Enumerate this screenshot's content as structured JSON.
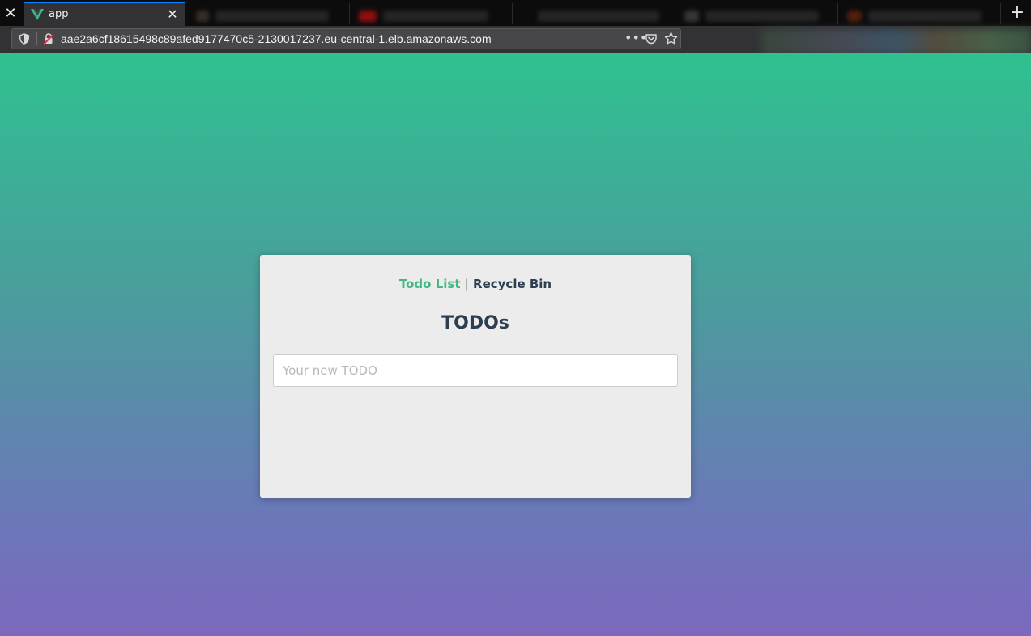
{
  "browser": {
    "active_tab": {
      "title": "app",
      "icon": "vue-logo-icon"
    },
    "url": "aae2a6cf18615498c89afed9177470c5-2130017237.eu-central-1.elb.amazonaws.com",
    "more_label": "•••",
    "colors": {
      "tab_accent": "#0a84ff",
      "vue_green": "#42b983"
    }
  },
  "app": {
    "nav": {
      "todo_list": "Todo List",
      "separator": "|",
      "recycle_bin": "Recycle Bin"
    },
    "title": "TODOs",
    "input": {
      "placeholder": "Your new TODO",
      "value": ""
    },
    "colors": {
      "accent": "#42b983",
      "text": "#2c3e50",
      "card": "#ececec",
      "gradient_top": "#2fc190",
      "gradient_bottom": "#7c68bd"
    }
  }
}
